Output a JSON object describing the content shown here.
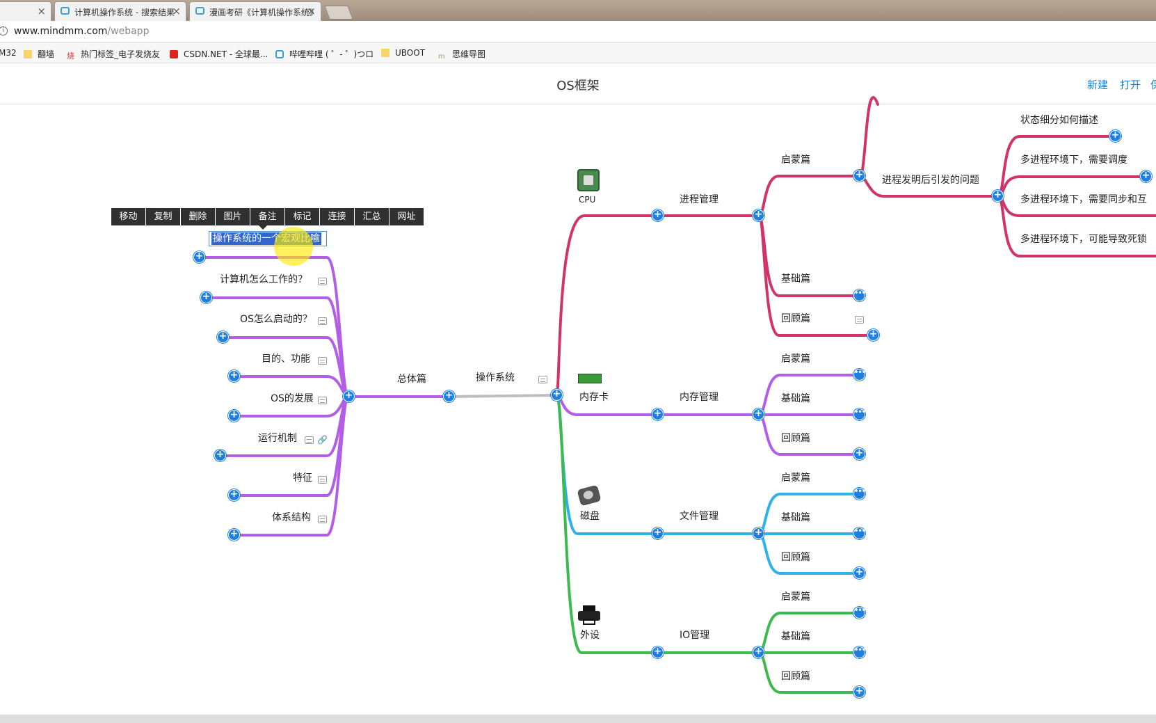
{
  "browser": {
    "tabs": [
      {
        "title": "",
        "close": "×"
      },
      {
        "title": "计算机操作系统 - 搜索结果",
        "close": "×"
      },
      {
        "title": "漫画考研《计算机操作系统》",
        "close": "×"
      }
    ],
    "address": {
      "host": "www.mindmm.com",
      "path": "/webapp"
    },
    "bookmarks": [
      {
        "label": "M32",
        "icon": "none"
      },
      {
        "label": "翻墙",
        "icon": "folder-icon"
      },
      {
        "label": "热门标签_电子发烧友",
        "icon": "fire-icon"
      },
      {
        "label": "CSDN.NET - 全球最...",
        "icon": "csdn-icon"
      },
      {
        "label": "哔哩哔哩 ( ゜- ゜)つロ",
        "icon": "bilibili-icon"
      },
      {
        "label": "UBOOT",
        "icon": "folder-icon"
      },
      {
        "label": "思维导图",
        "icon": "mindmap-icon"
      }
    ]
  },
  "app": {
    "title": "OS框架",
    "actions": [
      "新建",
      "打开",
      "保"
    ]
  },
  "toolbar": {
    "buttons": [
      "移动",
      "复制",
      "删除",
      "图片",
      "备注",
      "标记",
      "连接",
      "汇总",
      "网址"
    ]
  },
  "editing": {
    "text": "操作系统的一个宏观比喻"
  },
  "colors": {
    "purple": "#b35ee8",
    "crimson": "#d1336b",
    "cyan": "#2fb1ea",
    "green": "#3cba4f",
    "grey": "#bdbdbd",
    "button": "#1e7fe0"
  },
  "mindmap": {
    "root": "操作系统",
    "left_branch": {
      "label": "总体篇",
      "children": [
        "计算机怎么工作的？",
        "OS怎么启动的？",
        "目的、功能",
        "OS的发展",
        "运行机制",
        "特征",
        "体系结构"
      ]
    },
    "right_branches": [
      {
        "device": "CPU",
        "icon": "cpu-icon",
        "label": "进程管理",
        "color": "crimson",
        "children": [
          "启蒙篇",
          "基础篇",
          "回顾篇"
        ]
      },
      {
        "device": "内存卡",
        "icon": "memory-icon",
        "label": "内存管理",
        "color": "purple",
        "children": [
          "启蒙篇",
          "基础篇",
          "回顾篇"
        ]
      },
      {
        "device": "磁盘",
        "icon": "disk-icon",
        "label": "文件管理",
        "color": "cyan",
        "children": [
          "启蒙篇",
          "基础篇",
          "回顾篇"
        ]
      },
      {
        "device": "外设",
        "icon": "printer-icon",
        "label": "IO管理",
        "color": "green",
        "children": [
          "启蒙篇",
          "基础篇",
          "回顾篇"
        ]
      }
    ],
    "process_issue": {
      "label": "进程发明后引发的问题",
      "children": [
        "状态细分如何描述",
        "多进程环境下，需要调度",
        "多进程环境下，需要同步和互",
        "多进程环境下，可能导致死锁"
      ]
    }
  }
}
